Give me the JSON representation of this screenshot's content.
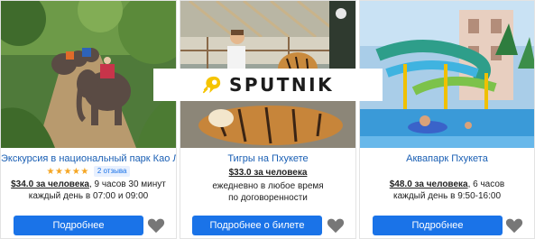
{
  "brand": {
    "name": "SPUTNIK",
    "accent": "#f5c400"
  },
  "colors": {
    "link": "#1a5fb4",
    "button": "#1a73e8",
    "star": "#f5a623",
    "heart": "#777777"
  },
  "cards": [
    {
      "title": "Экскурсия в национальный парк Као Лак",
      "stars": "★★★★★",
      "reviews": "2 отзыва",
      "price": "$34.0 за человека",
      "duration": ", 9 часов 30 минут",
      "schedule": "каждый день в 07:00 и 09:00",
      "button": "Подробнее",
      "favorite_icon": "heart-icon"
    },
    {
      "title": "Тигры на Пхукете",
      "price": "$33.0 за человека",
      "schedule": "ежедневно в любое время по договоренности",
      "button": "Подробнее о билете",
      "favorite_icon": "heart-icon"
    },
    {
      "title": "Аквапарк Пхукета",
      "price": "$48.0 за человека",
      "duration": ", 6 часов",
      "schedule": "каждый день в 9:50-16:00",
      "button": "Подробнее",
      "favorite_icon": "heart-icon"
    }
  ]
}
